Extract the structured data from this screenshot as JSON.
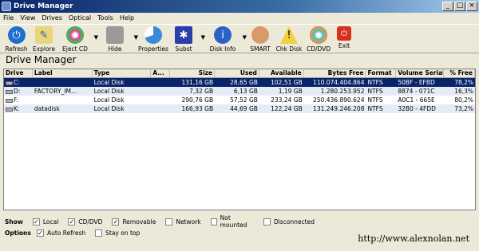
{
  "window": {
    "title": "Drive Manager"
  },
  "menu": [
    "File",
    "View",
    "Drives",
    "Optical",
    "Tools",
    "Help"
  ],
  "toolbar": [
    {
      "label": "Refresh",
      "icon": "refresh-icon"
    },
    {
      "label": "Explore",
      "icon": "explore-icon"
    },
    {
      "label": "Eject CD",
      "icon": "eject-cd-icon"
    },
    {
      "label": "Hide",
      "icon": "hide-icon"
    },
    {
      "label": "Properties",
      "icon": "properties-icon"
    },
    {
      "label": "Subst",
      "icon": "subst-icon"
    },
    {
      "label": "Disk Info",
      "icon": "disk-info-icon"
    },
    {
      "label": "SMART",
      "icon": "smart-icon"
    },
    {
      "label": "Chk Disk",
      "icon": "chk-disk-icon"
    },
    {
      "label": "CD/DVD",
      "icon": "cd-dvd-icon"
    },
    {
      "label": "Exit",
      "icon": "exit-icon"
    }
  ],
  "heading": "Drive Manager",
  "table": {
    "headers": [
      "Drive",
      "Label",
      "Type",
      "A...",
      "Size",
      "Used",
      "Available",
      "Bytes Free",
      "Format",
      "Volume Serial",
      "% Free"
    ],
    "rows": [
      {
        "drive": "C:",
        "label": "",
        "type": "Local Disk",
        "a": "",
        "size": "131,16 GB",
        "used": "28,65 GB",
        "avail": "102,51 GB",
        "free": "110.074.404.864",
        "fmt": "NTFS",
        "serial": "50BF - EFBD",
        "pct": "78,2%"
      },
      {
        "drive": "D:",
        "label": "FACTORY_IM...",
        "type": "Local Disk",
        "a": "",
        "size": "7,32 GB",
        "used": "6,13 GB",
        "avail": "1,19 GB",
        "free": "1.280.253.952",
        "fmt": "NTFS",
        "serial": "8874 - 071C",
        "pct": "16,3%"
      },
      {
        "drive": "F:",
        "label": "",
        "type": "Local Disk",
        "a": "",
        "size": "290,76 GB",
        "used": "57,52 GB",
        "avail": "233,24 GB",
        "free": "250.436.890.624",
        "fmt": "NTFS",
        "serial": "A0C1 - 665E",
        "pct": "80,2%"
      },
      {
        "drive": "K:",
        "label": "datadisk",
        "type": "Local Disk",
        "a": "",
        "size": "166,93 GB",
        "used": "44,69 GB",
        "avail": "122,24 GB",
        "free": "131.249.246.208",
        "fmt": "NTFS",
        "serial": "32B0 - 4FDD",
        "pct": "73,2%"
      }
    ]
  },
  "show": {
    "title": "Show",
    "items": [
      {
        "label": "Local",
        "checked": true
      },
      {
        "label": "CD/DVD",
        "checked": true
      },
      {
        "label": "Removable",
        "checked": true
      },
      {
        "label": "Network",
        "checked": false
      },
      {
        "label": "Not mounted",
        "checked": false
      },
      {
        "label": "Disconnected",
        "checked": false
      }
    ]
  },
  "options": {
    "title": "Options",
    "items": [
      {
        "label": "Auto Refresh",
        "checked": true
      },
      {
        "label": "Stay on top",
        "checked": false
      }
    ]
  },
  "url": "http://www.alexnolan.net"
}
